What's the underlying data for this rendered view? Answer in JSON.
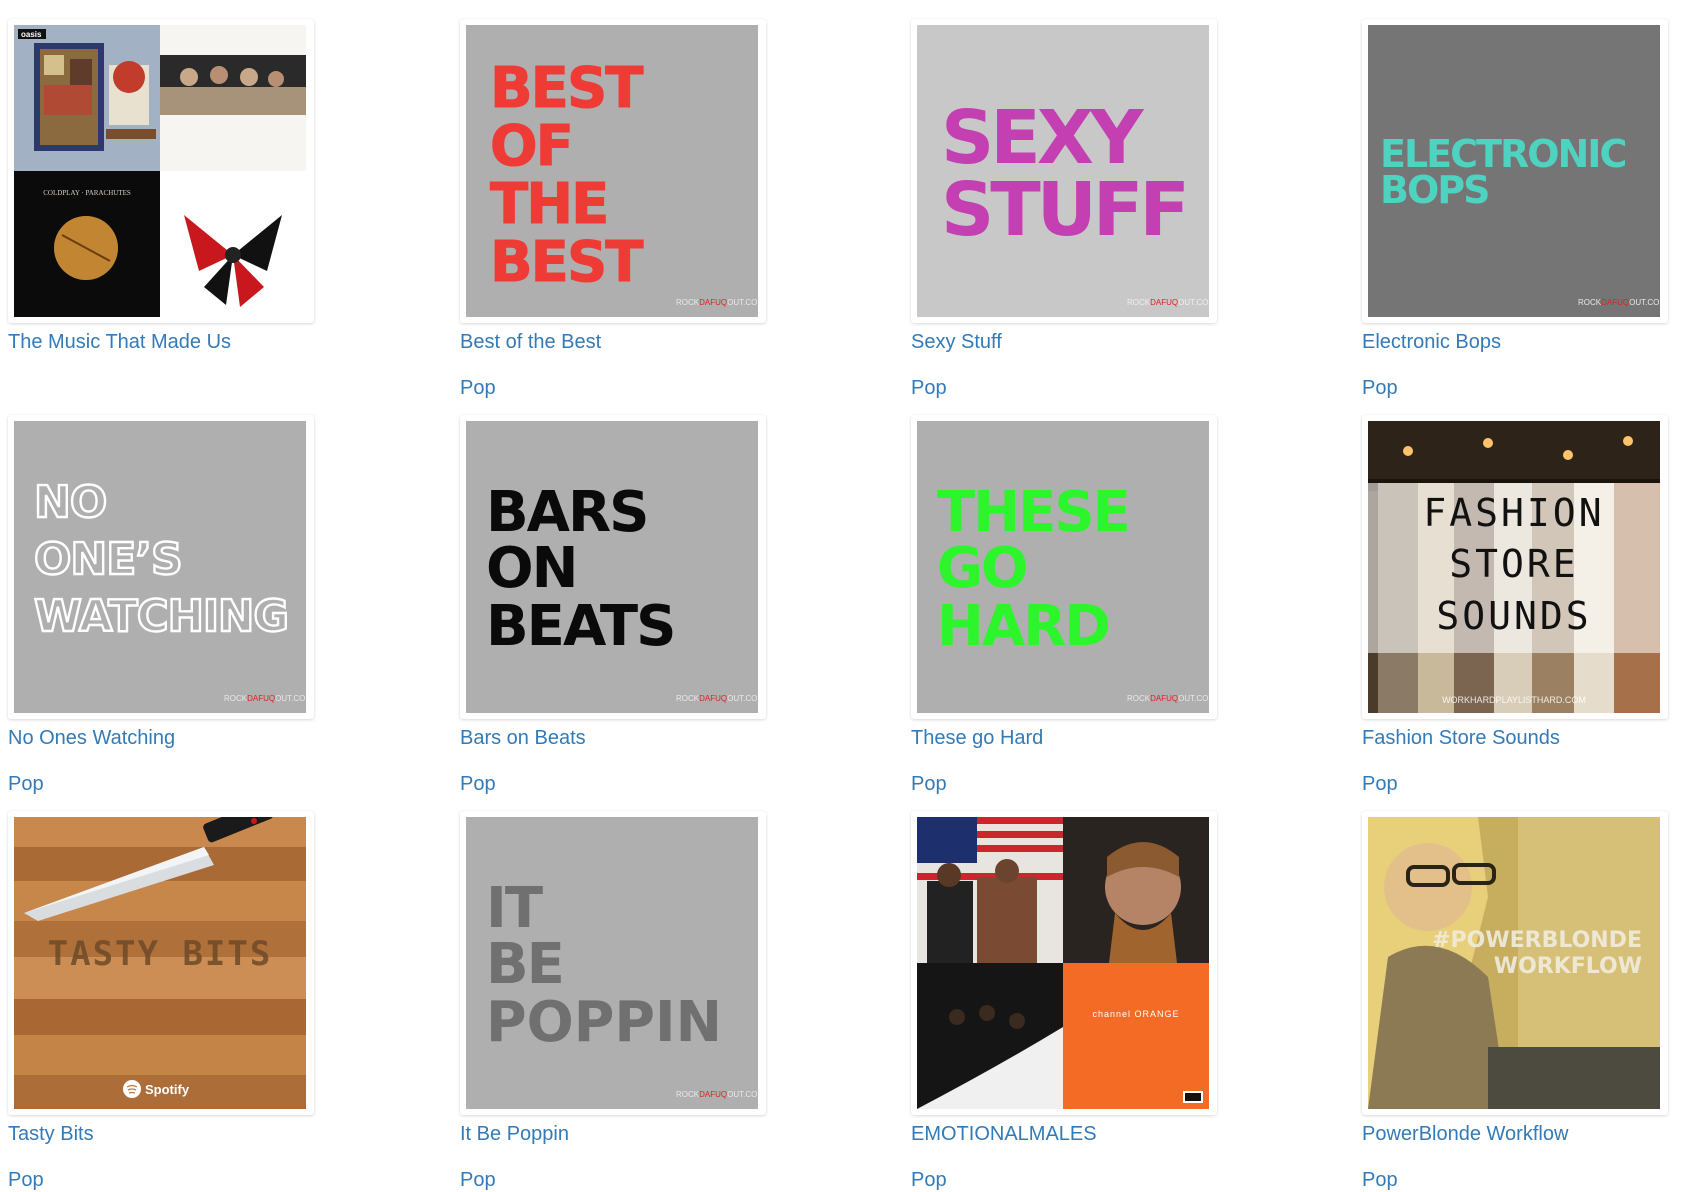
{
  "colors": {
    "link": "#337ab7",
    "tile_gray": "#afafaf",
    "tile_gray_light": "#c8c8c8",
    "tile_gray_dark": "#757575",
    "best_red": "#ef3b36",
    "sexy_magenta": "#c43fb2",
    "bops_teal": "#4fd3c1",
    "hard_green": "#2cf52c"
  },
  "watermark": {
    "rock": "ROCK",
    "dafuq": "DAFUQ",
    "out": "OUT.COM",
    "fashion": "WORKHARDPLAYLISTHARD.COM",
    "spotify": "Spotify"
  },
  "playlists": [
    {
      "title": "The Music That Made Us",
      "genre": "",
      "cover_icon": "album-collage-icon",
      "cover_text": [
        "oasis",
        "COLDPLAY · PARACHUTES"
      ]
    },
    {
      "title": "Best of the Best",
      "genre": "Pop",
      "cover_icon": "text-cover-icon",
      "cover_text": [
        "BEST",
        "OF",
        "THE",
        "BEST"
      ]
    },
    {
      "title": "Sexy Stuff",
      "genre": "Pop",
      "cover_icon": "text-cover-icon",
      "cover_text": [
        "SEXY",
        "STUFF"
      ]
    },
    {
      "title": "Electronic Bops",
      "genre": "Pop",
      "cover_icon": "text-cover-icon",
      "cover_text": [
        "ELECTRONIC",
        "BOPS"
      ]
    },
    {
      "title": "No Ones Watching",
      "genre": "Pop",
      "cover_icon": "text-cover-icon",
      "cover_text": [
        "NO",
        "ONE’S",
        "WATCHING"
      ]
    },
    {
      "title": "Bars on Beats",
      "genre": "Pop",
      "cover_icon": "text-cover-icon",
      "cover_text": [
        "BARS",
        "ON",
        "BEATS"
      ]
    },
    {
      "title": "These go Hard",
      "genre": "Pop",
      "cover_icon": "text-cover-icon",
      "cover_text": [
        "THESE",
        "GO",
        "HARD"
      ]
    },
    {
      "title": "Fashion Store Sounds",
      "genre": "Pop",
      "cover_icon": "clothes-rack-icon",
      "cover_text": [
        "FASHION",
        "STORE",
        "SOUNDS"
      ]
    },
    {
      "title": "Tasty Bits",
      "genre": "Pop",
      "cover_icon": "knife-cutting-board-icon",
      "cover_text": [
        "TASTY BITS"
      ]
    },
    {
      "title": "It Be Poppin",
      "genre": "Pop",
      "cover_icon": "text-cover-icon",
      "cover_text": [
        "IT",
        "BE",
        "POPPIN"
      ]
    },
    {
      "title": "EMOTIONALMALES",
      "genre": "Pop",
      "cover_icon": "album-collage-icon",
      "cover_text": [
        "channel ORANGE"
      ]
    },
    {
      "title": "PowerBlonde Workflow",
      "genre": "Pop",
      "cover_icon": "woman-laptop-photo-icon",
      "cover_text": [
        "#POWERBLONDE",
        "WORKFLOW"
      ]
    }
  ]
}
